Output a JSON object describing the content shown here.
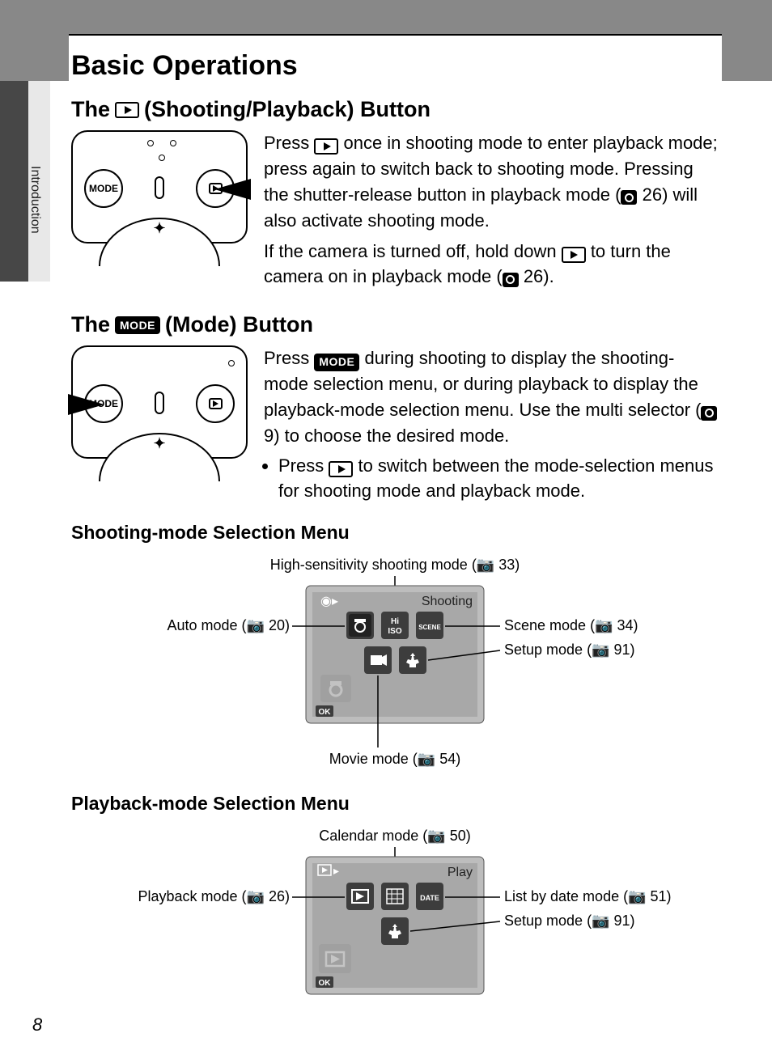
{
  "sidebar": {
    "label": "Introduction"
  },
  "section_title": "Basic Operations",
  "page_number": "8",
  "sec1": {
    "heading_pre": "The",
    "heading_post": "(Shooting/Playback) Button",
    "p1a": "Press ",
    "p1b": " once in shooting mode to enter playback mode; press again to switch back to shooting mode. Pressing the shutter-release button in playback mode (",
    "p1c": " 26) will also activate shooting mode.",
    "p2a": "If the camera is turned off, hold down ",
    "p2b": " to turn the camera on in playback mode (",
    "p2c": " 26)."
  },
  "sec2": {
    "heading_pre": "The",
    "heading_post": " (Mode) Button",
    "mode_label": "MODE",
    "p1a": "Press ",
    "p1b": " during shooting to display the shooting-mode selection menu, or during playback to display the playback-mode selection menu. Use the multi selector (",
    "p1c": " 9) to choose the desired mode.",
    "li_a": "Press ",
    "li_b": " to switch between the mode-selection menus for shooting mode and playback mode."
  },
  "shoot_menu": {
    "heading": "Shooting-mode Selection Menu",
    "screen_title": "Shooting",
    "labels": {
      "hi": {
        "text": "High-sensitivity shooting mode (",
        "ref": " 33)"
      },
      "auto": {
        "text": "Auto mode (",
        "ref": " 20)"
      },
      "scene": {
        "text": "Scene mode (",
        "ref": " 34)"
      },
      "setup": {
        "text": "Setup mode (",
        "ref": " 91)"
      },
      "movie": {
        "text": "Movie mode (",
        "ref": " 54)"
      }
    },
    "icons": {
      "auto": "AUTO",
      "hi": "Hi\nISO",
      "scene": "SCENE",
      "movie": "MOVIE",
      "setup": "SETUP",
      "ok": "OK"
    }
  },
  "play_menu": {
    "heading": "Playback-mode Selection Menu",
    "screen_title": "Play",
    "labels": {
      "cal": {
        "text": "Calendar mode (",
        "ref": " 50)"
      },
      "play": {
        "text": "Playback mode (",
        "ref": " 26)"
      },
      "date": {
        "text": "List by date mode (",
        "ref": " 51)"
      },
      "setup": {
        "text": "Setup mode (",
        "ref": " 91)"
      }
    },
    "icons": {
      "play": "PLAY",
      "cal": "CAL",
      "date": "DATE",
      "setup": "SETUP",
      "ok": "OK"
    }
  }
}
